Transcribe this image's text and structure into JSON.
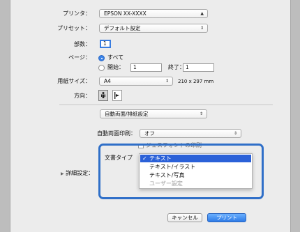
{
  "printer": {
    "label": "プリンタ：",
    "value": "EPSON XX-XXXX"
  },
  "preset": {
    "label": "プリセット：",
    "value": "デフォルト設定"
  },
  "copies": {
    "label": "部数：",
    "value": "1"
  },
  "pages": {
    "label": "ページ：",
    "all_label": "すべて",
    "from_label": "開始：",
    "from_value": "1",
    "to_label": "終了：",
    "to_value": "1"
  },
  "paper": {
    "label": "用紙サイズ：",
    "value": "A4",
    "size_text": "210 x 297 mm"
  },
  "orientation": {
    "label": "方向："
  },
  "section_popup": {
    "value": "自動両面/排紙設定"
  },
  "duplex": {
    "label": "自動両面印刷：",
    "value": "オフ"
  },
  "hidden_row": {
    "text": "ジェスフォントの印刷"
  },
  "doc_type": {
    "label": "文書タイプ",
    "options": [
      "テキスト",
      "テキスト/イラスト",
      "テキスト/写真",
      "ユーザー設定"
    ],
    "check_glyph": "✓"
  },
  "advanced": {
    "label": "詳細設定："
  },
  "buttons": {
    "cancel": "キャンセル",
    "print": "プリント"
  },
  "colors": {
    "accent": "#2b61d8",
    "focus": "#2f6fc8"
  }
}
